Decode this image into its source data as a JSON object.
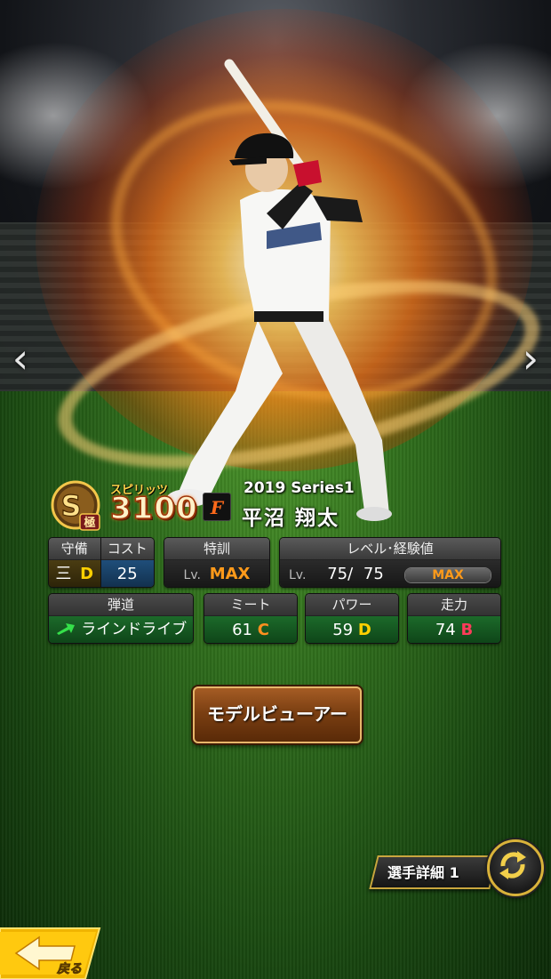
{
  "player": {
    "series": "2019 Series1",
    "name": "平沼 翔太",
    "rank_letter": "S",
    "rank_grade": "極",
    "spirit_label": "スピリッツ",
    "spirit_value": "3100",
    "team_letter": "F"
  },
  "stats": {
    "defense": {
      "label": "守備",
      "position": "三",
      "grade": "D"
    },
    "cost": {
      "label": "コスト",
      "value": "25"
    },
    "training": {
      "label": "特訓",
      "lv_prefix": "Lv.",
      "value": "MAX"
    },
    "level": {
      "label": "レベル･経験値",
      "lv_prefix": "Lv.",
      "current": "75",
      "max": "75",
      "bar_text": "MAX",
      "exp_fill": 1.0
    },
    "trajectory": {
      "label": "弾道",
      "value": "ラインドライブ"
    },
    "meet": {
      "label": "ミート",
      "value": "61",
      "grade": "C"
    },
    "power": {
      "label": "パワー",
      "value": "59",
      "grade": "D"
    },
    "speed": {
      "label": "走力",
      "value": "74",
      "grade": "B"
    }
  },
  "buttons": {
    "model_viewer": "モデルビューアー",
    "player_detail": "選手詳細 1",
    "back": "戻る"
  },
  "colors": {
    "accent_gold": "#d9b23a",
    "grade_b": "#ff3b5a",
    "grade_c": "#ff8f1f",
    "grade_d": "#ffd000",
    "max_orange": "#ff9a1a",
    "green_panel": "#1c6a2a"
  },
  "icons": {
    "prev": "chevron-left-icon",
    "next": "chevron-right-icon",
    "swap": "swap-arrows-icon",
    "back": "back-arrow-icon",
    "trajectory": "arrow-up-right-icon"
  }
}
